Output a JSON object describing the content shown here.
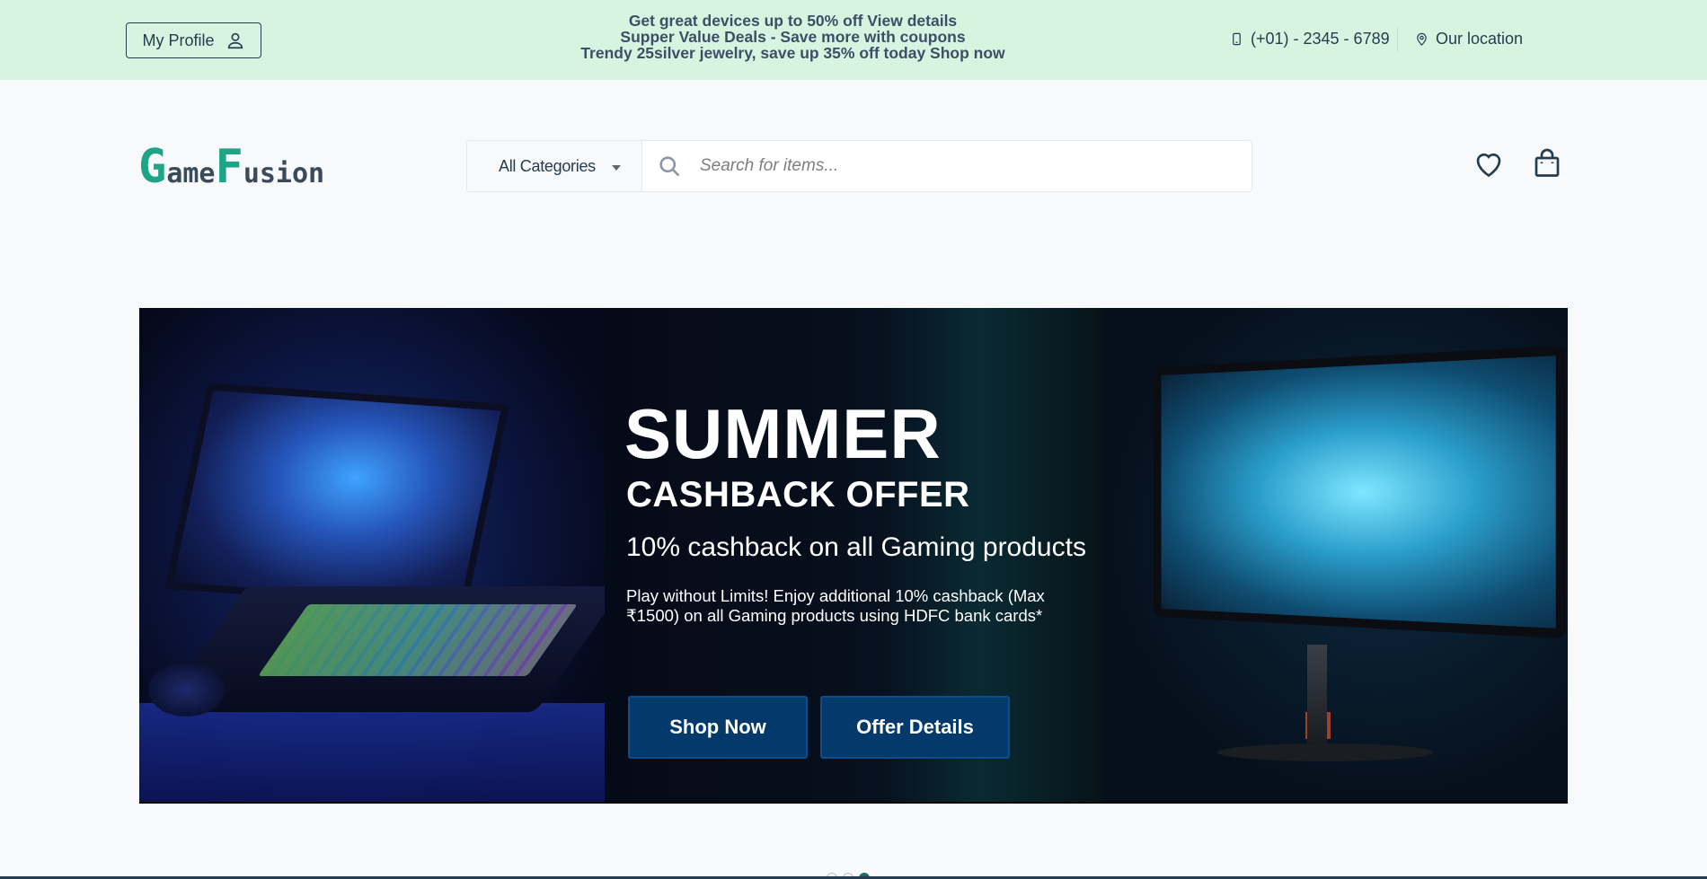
{
  "topbar": {
    "profile_label": "My Profile",
    "promo_lines": [
      "Get great devices up to 50% off View details",
      "Supper Value Deals - Save more with coupons",
      "Trendy 25silver jewelry, save up 35% off today Shop now"
    ],
    "phone": "(+01) - 2345 - 6789",
    "location": "Our location"
  },
  "header": {
    "logo": {
      "cap1": "G",
      "rest1": "ame",
      "cap2": "F",
      "rest2": "usion"
    },
    "category_select": "All Categories",
    "search_placeholder": "Search for items..."
  },
  "banner": {
    "title": "SUMMER",
    "subtitle": "CASHBACK OFFER",
    "headline": "10% cashback on all Gaming products",
    "description": "Play without Limits! Enjoy additional 10% cashback (Max ₹1500) on all Gaming products using HDFC bank cards*",
    "shop_button": "Shop Now",
    "offer_button": "Offer Details"
  },
  "carousel": {
    "slide_count": 3,
    "active_index": 2
  },
  "colors": {
    "topbar_bg": "#d7f4e1",
    "brand_green": "#1ea487",
    "text_dark": "#253d4e",
    "banner_button": "#04396b"
  }
}
